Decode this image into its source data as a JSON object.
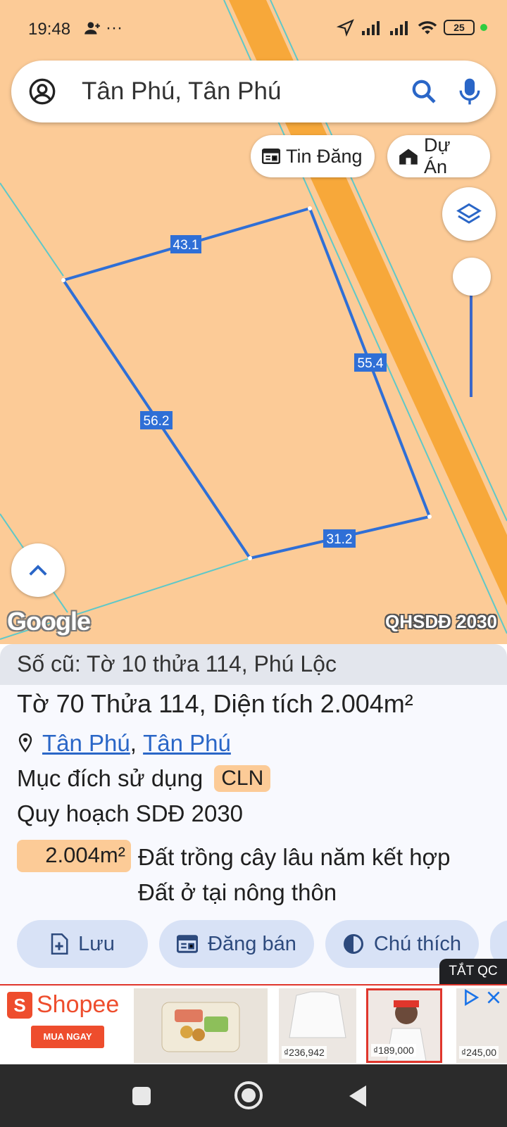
{
  "status_bar": {
    "time": "19:48",
    "extra": "···",
    "battery": "25"
  },
  "search": {
    "query": "Tân Phú, Tân Phú"
  },
  "chips": {
    "listing": "Tin Đăng",
    "project": "Dự Án"
  },
  "map": {
    "edges": {
      "top": "43.1",
      "right": "55.4",
      "left": "56.2",
      "bottom": "31.2"
    },
    "attribution": "Google",
    "layer": "QHSDĐ 2030"
  },
  "parcel": {
    "old_number": "Số cũ: Tờ 10 thửa 114, Phú Lộc",
    "sheet_label": "Tờ",
    "sheet_no": "70",
    "plot_label": "Thửa",
    "plot_no": "114",
    "area_label": ", Diện tích",
    "area_value": "2.004",
    "area_unit": "m²",
    "ward": "Tân Phú",
    "district": "Tân Phú",
    "address_sep": ",",
    "purpose_label": "Mục đích sử dụng",
    "purpose_code": "CLN",
    "plan_label": "Quy hoạch SDĐ 2030",
    "plan_area": "2.004m²",
    "plan_type_line1": "Đất trồng cây lâu năm kết hợp",
    "plan_type_line2": "Đất ở tại nông thôn"
  },
  "actions": {
    "save": "Lưu",
    "post_sale": "Đăng bán",
    "legend": "Chú thích"
  },
  "ad": {
    "toggle": "TẮT QC",
    "brand": "Shopee",
    "cta": "MUA NGAY",
    "prices": [
      "₫236,942",
      "₫189,000",
      "₫245,00"
    ]
  },
  "colors": {
    "map_bg": "#fccb97",
    "road": "#f7a83a",
    "parcel_line": "#2f6fd6",
    "accent": "#2a66c7"
  }
}
